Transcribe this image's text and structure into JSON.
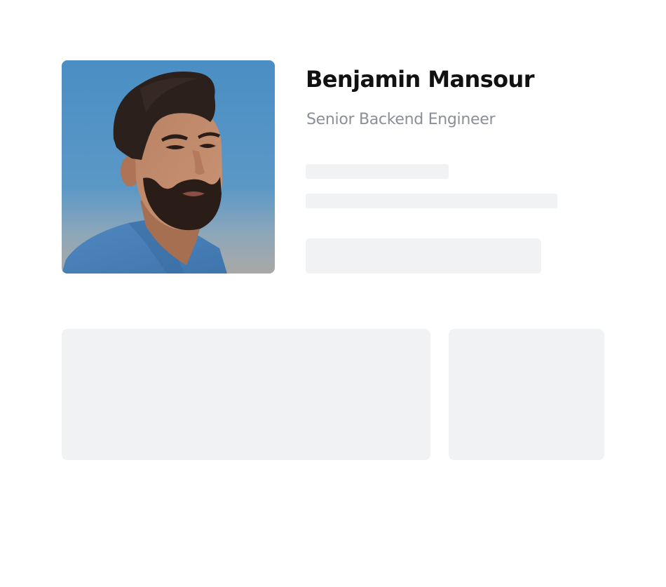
{
  "profile": {
    "name": "Benjamin Mansour",
    "role": "Senior Backend Engineer",
    "avatar_icon": "profile-photo"
  },
  "colors": {
    "name_text": "#111111",
    "role_text": "#8a8f98",
    "skeleton": "#f1f2f4",
    "photo_sky": "#4f8fc1",
    "photo_shirt": "#4d86bd"
  }
}
